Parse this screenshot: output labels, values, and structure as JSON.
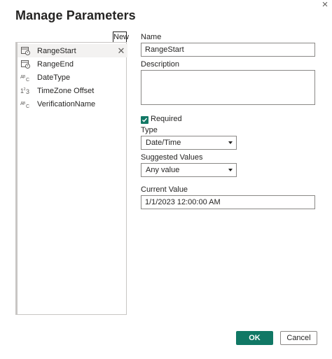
{
  "dialog": {
    "title": "Manage Parameters",
    "close_glyph": "×",
    "new_label": "New"
  },
  "parameters": [
    {
      "name": "RangeStart",
      "icon": "date-time-icon",
      "selected": true
    },
    {
      "name": "RangeEnd",
      "icon": "date-time-icon",
      "selected": false
    },
    {
      "name": "DateType",
      "icon": "text-type-icon",
      "selected": false
    },
    {
      "name": "TimeZone Offset",
      "icon": "number-type-icon",
      "selected": false
    },
    {
      "name": "VerificationName",
      "icon": "text-type-icon",
      "selected": false
    }
  ],
  "form": {
    "name_label": "Name",
    "name_value": "RangeStart",
    "description_label": "Description",
    "description_value": "",
    "required_label": "Required",
    "required_checked": true,
    "type_label": "Type",
    "type_value": "Date/Time",
    "suggested_label": "Suggested Values",
    "suggested_value": "Any value",
    "current_label": "Current Value",
    "current_value": "1/1/2023 12:00:00 AM"
  },
  "buttons": {
    "ok": "OK",
    "cancel": "Cancel"
  },
  "colors": {
    "accent": "#117865"
  }
}
